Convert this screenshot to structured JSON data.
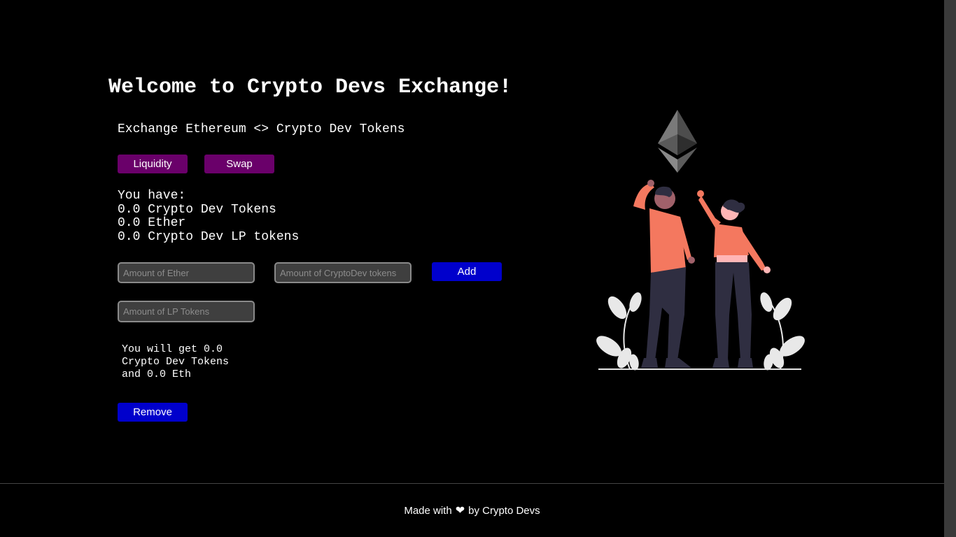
{
  "header": {
    "title": "Welcome to Crypto Devs Exchange!"
  },
  "subtitle": "Exchange Ethereum <> Crypto Dev Tokens",
  "tabs": {
    "liquidity_label": "Liquidity",
    "swap_label": "Swap"
  },
  "balances": {
    "heading": "You have:",
    "cd_tokens": "0.0 Crypto Dev Tokens",
    "ether": "0.0 Ether",
    "lp_tokens": "0.0 Crypto Dev LP tokens"
  },
  "add_liquidity": {
    "ether_placeholder": "Amount of Ether",
    "cd_placeholder": "Amount of CryptoDev tokens",
    "add_label": "Add"
  },
  "remove_liquidity": {
    "lp_placeholder": "Amount of LP Tokens",
    "receive_line1": "You will get 0.0",
    "receive_line2": "Crypto Dev Tokens",
    "receive_line3": "and 0.0 Eth",
    "remove_label": "Remove"
  },
  "footer": {
    "made_with": "Made with",
    "heart": "❤",
    "by": "by Crypto Devs"
  },
  "colors": {
    "purple_button": "#6a006a",
    "blue_button": "#0000cc",
    "background": "#000000"
  },
  "icons": {
    "illustration": "ethereum-celebration-illustration",
    "heart": "heart-icon"
  }
}
